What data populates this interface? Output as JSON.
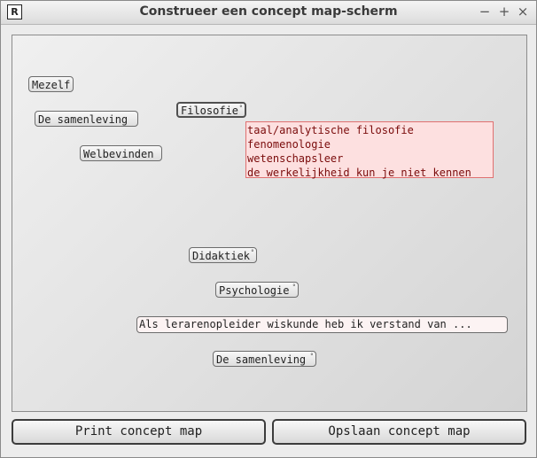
{
  "window": {
    "title": "Construeer een concept map-scherm",
    "icon_label": "R",
    "controls": {
      "minimize": "−",
      "maximize": "+",
      "close": "×"
    }
  },
  "map": {
    "concepts": {
      "mezelf": "Mezelf",
      "samenleving_top": "De samenleving",
      "filosofie": "Filosofie",
      "welbevinden": "Welbevinden",
      "didaktiek": "Didaktiek",
      "psychologie": "Psychologie",
      "samenleving_bottom": "De samenleving"
    },
    "expansion_dot": "°",
    "filosofie_details": [
      "taal/analytische filosofie",
      "fenomenologie",
      "wetenschapsleer",
      "de werkelijkheid kun je niet kennen"
    ],
    "prompt": "Als lerarenopleider wiskunde heb ik verstand van ..."
  },
  "buttons": {
    "print": "Print concept map",
    "save": "Opslaan concept map"
  },
  "colors": {
    "detail_text": "#7a0b0b",
    "detail_background": "#fde0e0",
    "detail_border": "#e07070"
  }
}
